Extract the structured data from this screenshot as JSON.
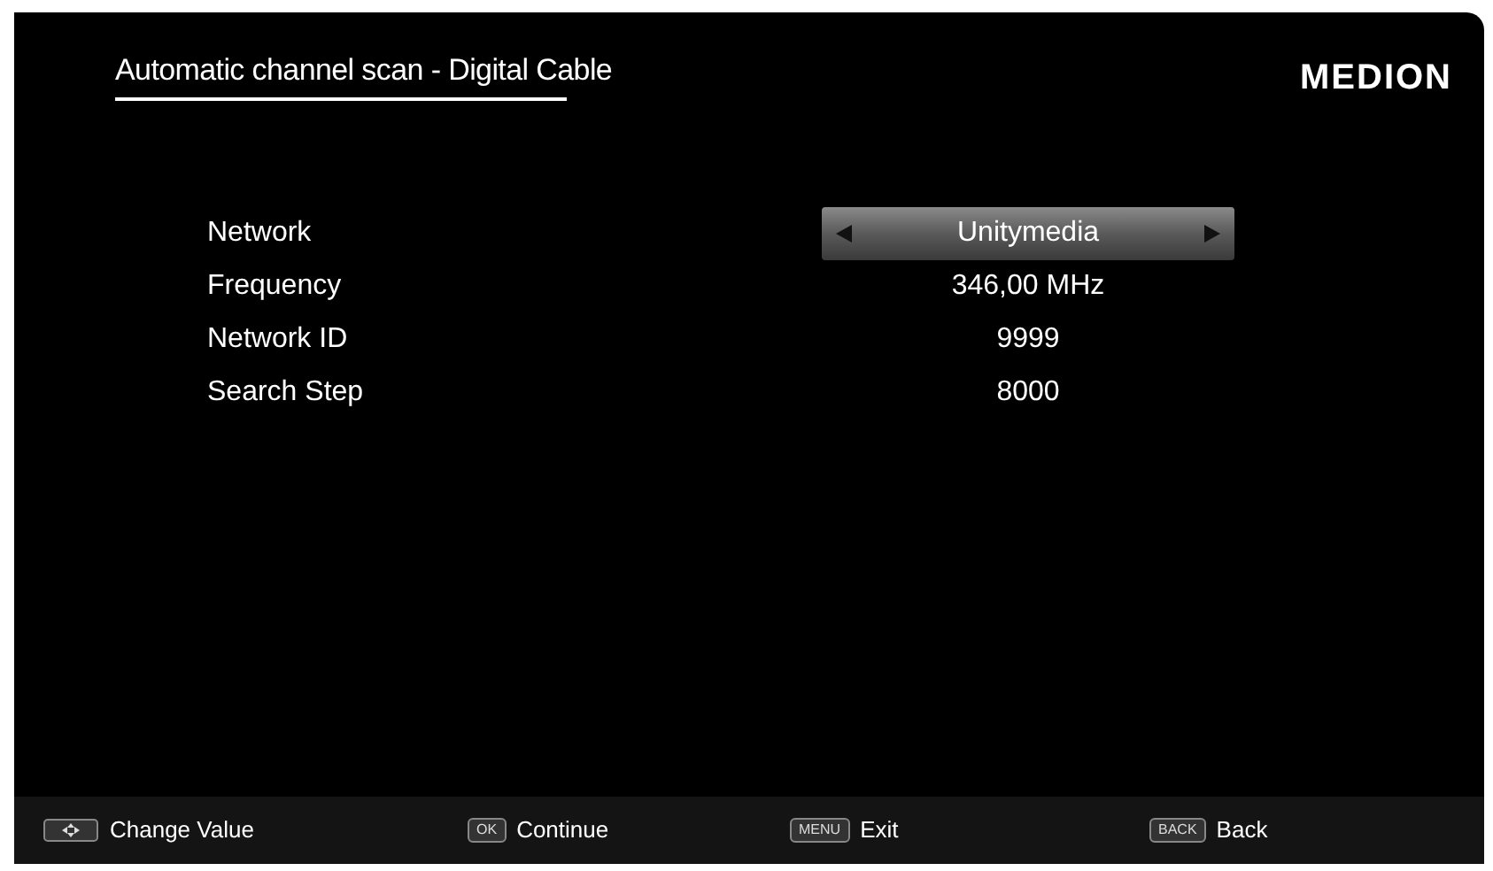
{
  "title": "Automatic channel scan - Digital Cable",
  "logo": "MEDION",
  "settings": [
    {
      "label": "Network",
      "value": "Unitymedia",
      "selected": true
    },
    {
      "label": "Frequency",
      "value": "346,00 MHz",
      "selected": false
    },
    {
      "label": "Network ID",
      "value": "9999",
      "selected": false
    },
    {
      "label": "Search Step",
      "value": "8000",
      "selected": false
    }
  ],
  "footer": [
    {
      "kind": "arrows",
      "label": "Change Value"
    },
    {
      "kind": "key",
      "key": "OK",
      "label": "Continue"
    },
    {
      "kind": "key",
      "key": "MENU",
      "label": "Exit"
    },
    {
      "kind": "key",
      "key": "BACK",
      "label": "Back"
    }
  ]
}
